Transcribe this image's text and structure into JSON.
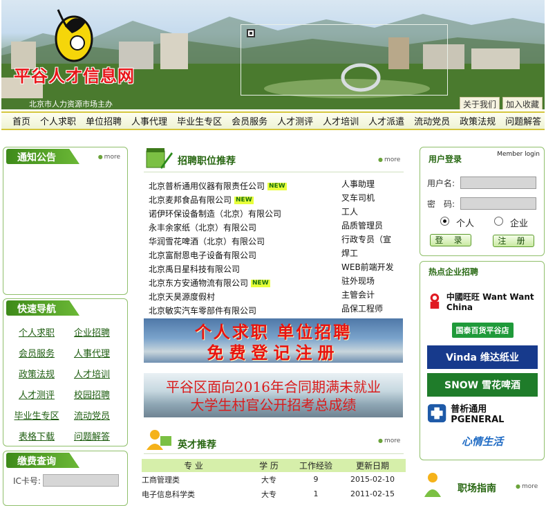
{
  "site": {
    "title": "平谷人才信息网",
    "organizer": "北京市人力资源市场主办",
    "top_links": [
      "关于我们",
      "加入收藏"
    ]
  },
  "nav": [
    "首页",
    "个人求职",
    "单位招聘",
    "人事代理",
    "毕业生专区",
    "会员服务",
    "人才测评",
    "人才培训",
    "人才派遣",
    "流动党员",
    "政策法规",
    "问题解答"
  ],
  "more_label": "more",
  "notice": {
    "title": "通知公告"
  },
  "quick_nav": {
    "title": "快速导航",
    "links": [
      "个人求职",
      "企业招聘",
      "会员服务",
      "人事代理",
      "政策法规",
      "人才培训",
      "人才测评",
      "校园招聘",
      "毕业生专区",
      "流动党员",
      "表格下载",
      "问题解答"
    ]
  },
  "fee_query": {
    "title": "缴费查询",
    "ic_label": "IC卡号:"
  },
  "recruit": {
    "title": "招聘职位推荐",
    "companies": [
      {
        "name": "北京普析通用仪器有限责任公司",
        "badge": "NEW"
      },
      {
        "name": "北京麦邦食品有限公司",
        "badge": "NEW"
      },
      {
        "name": "诺伊环保设备制造（北京）有限公司",
        "badge": ""
      },
      {
        "name": "永丰余家纸（北京）有限公司",
        "badge": ""
      },
      {
        "name": "华润雪花啤酒（北京）有限公司",
        "badge": ""
      },
      {
        "name": "北京富耐恩电子设备有限公司",
        "badge": ""
      },
      {
        "name": "北京禹日星科技有限公司",
        "badge": ""
      },
      {
        "name": "北京东方安通物流有限公司",
        "badge": "NEW"
      },
      {
        "name": "北京天昊源度假村",
        "badge": ""
      },
      {
        "name": "北京敏实汽车零部件有限公司",
        "badge": ""
      }
    ],
    "positions": [
      "人事助理",
      "叉车司机",
      "工人",
      "品质管理员",
      "行政专员（宣",
      "焊工",
      "WEB前端开发",
      "驻外现场",
      "主管会计",
      "品保工程师"
    ]
  },
  "promo1": {
    "line1": "个人求职  单位招聘",
    "line2": "免费登记注册"
  },
  "promo2": {
    "line1": "平谷区面向2016年合同期满未就业",
    "line2": "大学生村官公开招考总成绩"
  },
  "talent": {
    "title": "英才推荐",
    "headers": [
      "专  业",
      "学 历",
      "工作经验",
      "更新日期"
    ],
    "rows": [
      [
        "工商管理类",
        "大专",
        "9",
        "2015-02-10"
      ],
      [
        "电子信息科学类",
        "大专",
        "1",
        "2011-02-15"
      ]
    ]
  },
  "login": {
    "title": "用户登录",
    "subtitle": "Member login",
    "username_label": "用户名:",
    "password_label": "密　码:",
    "options": [
      "个人",
      "企业"
    ],
    "selected": "个人",
    "login_btn": "登 录",
    "register_btn": "注 册"
  },
  "hot": {
    "title": "热点企业招聘",
    "logos": [
      "中國旺旺 Want Want China",
      "国泰百货平谷店",
      "Vinda 维达纸业",
      "SNOW 雪花啤酒",
      "普析通用 PGENERAL",
      "心情生活"
    ]
  },
  "guide": {
    "title": "职场指南"
  }
}
